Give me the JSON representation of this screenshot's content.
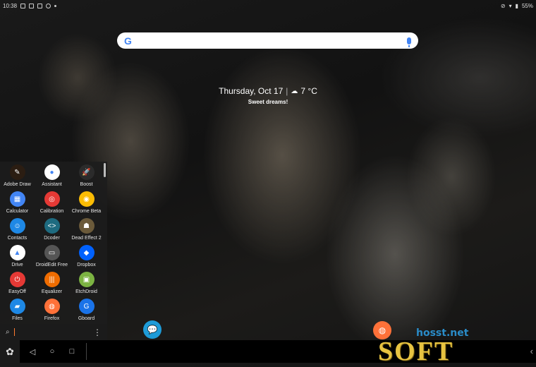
{
  "status": {
    "time": "10:38",
    "battery": "55%"
  },
  "search": {
    "logo": "G"
  },
  "glance": {
    "date": "Thursday, Oct 17",
    "temp": "7 °C",
    "subtitle": "Sweet dreams!"
  },
  "colors": {
    "accent": "#ff7a2f",
    "drawer_bg": "#1c1c1c"
  },
  "apps": [
    {
      "label": "Adobe Draw",
      "icon": "adobe-draw-icon",
      "color": "#2b1d12",
      "glyph": "✎"
    },
    {
      "label": "Assistant",
      "icon": "assistant-icon",
      "color": "#ffffff",
      "glyph": "●"
    },
    {
      "label": "Boost",
      "icon": "boost-icon",
      "color": "#2b2b2b",
      "glyph": "🚀"
    },
    {
      "label": "Calculator",
      "icon": "calculator-icon",
      "color": "#4285f4",
      "glyph": "▦"
    },
    {
      "label": "Calibration",
      "icon": "calibration-icon",
      "color": "#e53935",
      "glyph": "◎"
    },
    {
      "label": "Chrome Beta",
      "icon": "chrome-beta-icon",
      "color": "#fbbc04",
      "glyph": "◉"
    },
    {
      "label": "Contacts",
      "icon": "contacts-icon",
      "color": "#1e88e5",
      "glyph": "☺"
    },
    {
      "label": "Dcoder",
      "icon": "dcoder-icon",
      "color": "#1e6b80",
      "glyph": "<>"
    },
    {
      "label": "Dead Effect 2",
      "icon": "dead-effect-icon",
      "color": "#6b5a3a",
      "glyph": "☗"
    },
    {
      "label": "Drive",
      "icon": "drive-icon",
      "color": "#ffffff",
      "glyph": "▲"
    },
    {
      "label": "DroidEdit Free",
      "icon": "droidedit-icon",
      "color": "#555555",
      "glyph": "▭"
    },
    {
      "label": "Dropbox",
      "icon": "dropbox-icon",
      "color": "#0061fe",
      "glyph": "◆"
    },
    {
      "label": "EasyOff",
      "icon": "easyoff-icon",
      "color": "#e53935",
      "glyph": "⏻"
    },
    {
      "label": "Equalizer",
      "icon": "equalizer-icon",
      "color": "#ef6c00",
      "glyph": "|||"
    },
    {
      "label": "EtchDroid",
      "icon": "etchdroid-icon",
      "color": "#7cb342",
      "glyph": "▣"
    },
    {
      "label": "Files",
      "icon": "files-icon",
      "color": "#1e88e5",
      "glyph": "▰"
    },
    {
      "label": "Firefox",
      "icon": "firefox-icon",
      "color": "#ff7139",
      "glyph": "◍"
    },
    {
      "label": "Gboard",
      "icon": "gboard-icon",
      "color": "#1a73e8",
      "glyph": "G"
    }
  ],
  "watermark": {
    "small": "hosst.net",
    "big": "SOFT"
  }
}
